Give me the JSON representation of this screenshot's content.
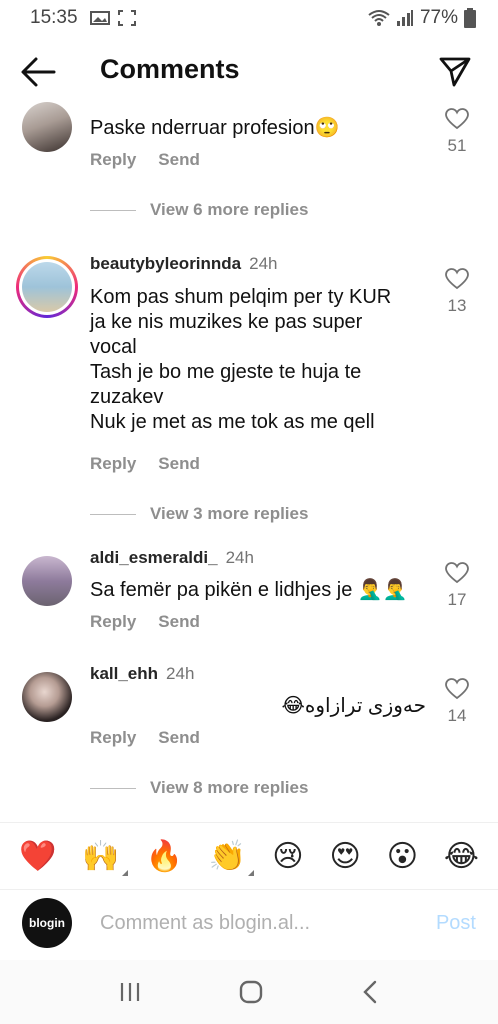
{
  "status": {
    "time": "15:35",
    "battery": "77%"
  },
  "header": {
    "title": "Comments"
  },
  "comments": [
    {
      "username": "",
      "time": "",
      "text": "Paske nderruar profesion🙄",
      "reply": "Reply",
      "send": "Send",
      "likes": "51",
      "more": "View 6 more replies"
    },
    {
      "username": "beautybyleorinnda",
      "time": "24h",
      "text": "Kom pas shum pelqim per ty KUR\nja ke nis muzikes ke pas super\nvocal\nTash je bo me gjeste te huja te\nzuzakev\nNuk je met as me tok as me qell",
      "reply": "Reply",
      "send": "Send",
      "likes": "13",
      "more": "View 3 more replies"
    },
    {
      "username": "aldi_esmeraldi_",
      "time": "24h",
      "text": "Sa femër pa pikën e lidhjes je 🤦‍♂️🤦‍♂️",
      "reply": "Reply",
      "send": "Send",
      "likes": "17"
    },
    {
      "username": "kall_ehh",
      "time": "24h",
      "text": "حەوزی ترازاوە😂",
      "reply": "Reply",
      "send": "Send",
      "likes": "14",
      "more": "View 8 more replies"
    }
  ],
  "emojis": [
    "❤️",
    "🙌",
    "🔥",
    "👏",
    "😢",
    "😍",
    "😮",
    "😂"
  ],
  "composer": {
    "placeholder": "Comment as blogin.al...",
    "post": "Post",
    "avatar_text": "blogin"
  },
  "colors": {
    "accent_post": "#b3dbff",
    "text_muted": "#8e8e8e"
  },
  "icons": {
    "back": "arrow-left-icon",
    "send": "paper-plane-icon",
    "like": "heart-outline-icon"
  }
}
